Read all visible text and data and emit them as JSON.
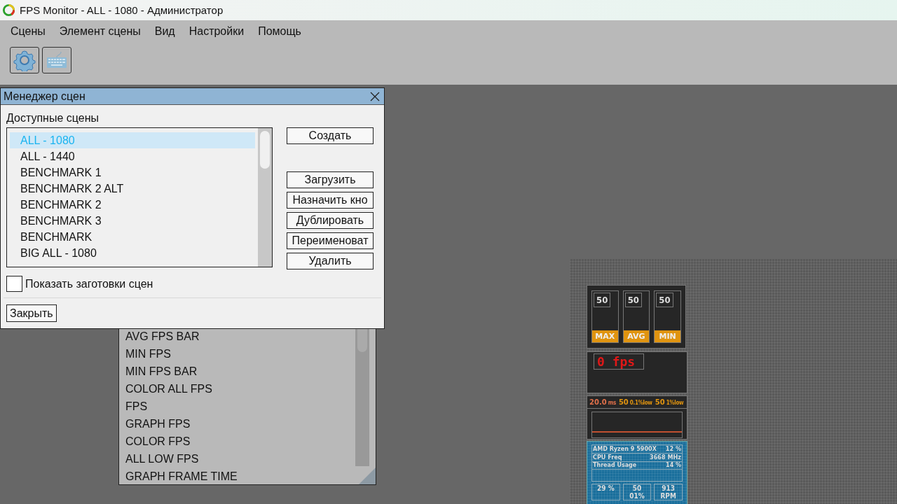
{
  "window": {
    "title": "FPS Monitor - ALL - 1080 - Администратор"
  },
  "menu": [
    "Сцены",
    "Элемент сцены",
    "Вид",
    "Настройки",
    "Помощь"
  ],
  "toolbar": [
    {
      "kind": "gear"
    },
    {
      "kind": "keyboard"
    }
  ],
  "element_list": {
    "items": [
      "AVG FPS BAR",
      "MIN FPS",
      "MIN FPS BAR",
      "COLOR ALL FPS",
      "FPS",
      "GRAPH FPS",
      "COLOR FPS",
      "ALL LOW FPS",
      "GRAPH FRAME TIME"
    ]
  },
  "dialog": {
    "title": "Менеджер сцен",
    "list_label": "Доступные сцены",
    "scenes": [
      {
        "label": "ALL - 1080",
        "selected": true
      },
      {
        "label": "ALL - 1440",
        "selected": false
      },
      {
        "label": "BENCHMARK 1",
        "selected": false
      },
      {
        "label": "BENCHMARK 2 ALT",
        "selected": false
      },
      {
        "label": "BENCHMARK 2",
        "selected": false
      },
      {
        "label": "BENCHMARK 3",
        "selected": false
      },
      {
        "label": "BENCHMARK",
        "selected": false
      },
      {
        "label": "BIG ALL - 1080",
        "selected": false
      }
    ],
    "buttons": [
      "Создать",
      "Загрузить",
      "Назначить кно",
      "Дублировать",
      "Переименоват",
      "Удалить"
    ],
    "checkbox": {
      "label": "Показать заготовки сцен",
      "checked": false
    },
    "close_button": "Закрыть"
  },
  "overlay": {
    "bars": [
      {
        "value": "50",
        "label": "MAX"
      },
      {
        "value": "50",
        "label": "AVG"
      },
      {
        "value": "50",
        "label": "MIN"
      }
    ],
    "fps": "0 fps",
    "frametime": [
      {
        "value": "20.0",
        "unit": "ms"
      },
      {
        "value": "50",
        "unit": "0.1%low"
      },
      {
        "value": "50",
        "unit": "1%low"
      }
    ],
    "cpu": {
      "name": "AMD Ryzen 9 5900X",
      "load": "12 %",
      "freq_label": "CPU Freq",
      "freq": "3668 MHz",
      "thread_label": "Thread Usage",
      "thread": "14 %"
    },
    "stats": [
      [
        "29 %"
      ],
      [
        "50",
        "01%"
      ],
      [
        "913",
        "RPM"
      ]
    ]
  }
}
